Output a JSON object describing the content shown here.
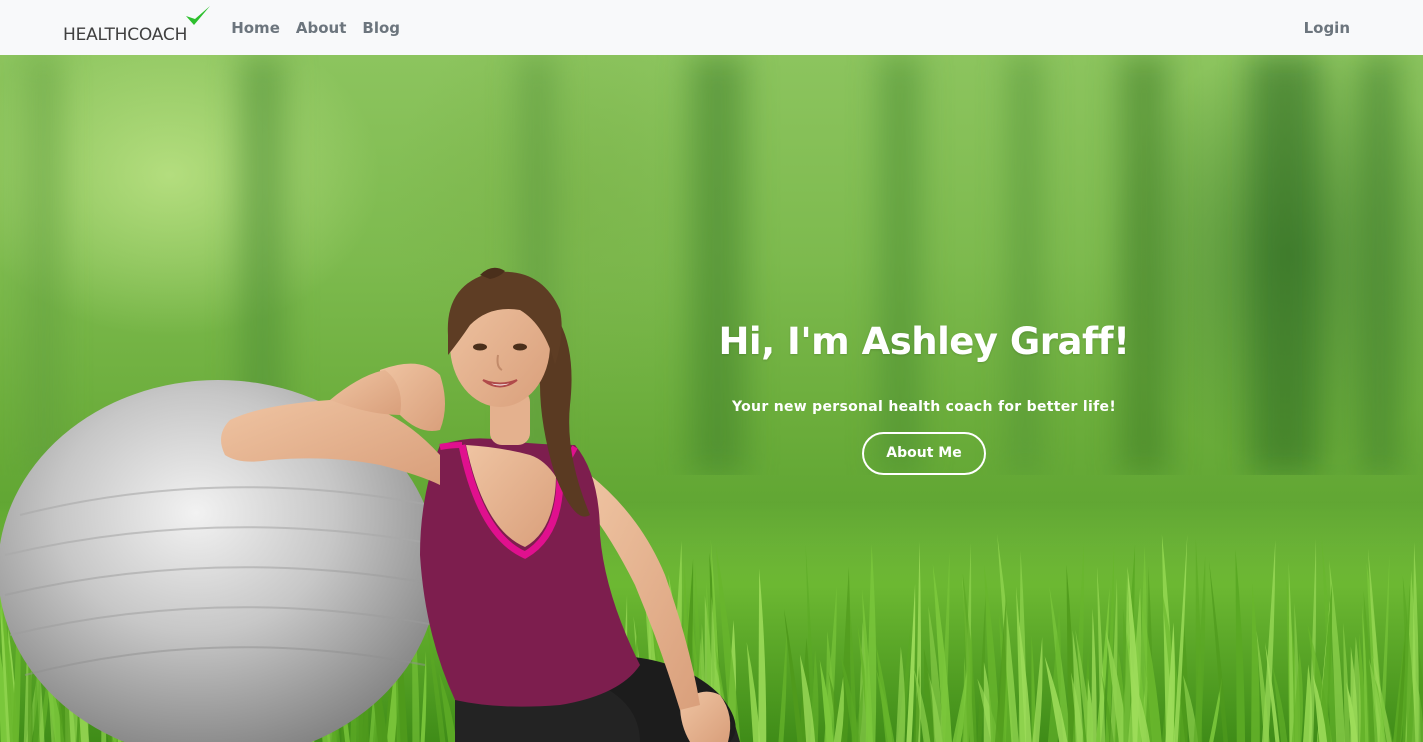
{
  "navbar": {
    "brand": "HEALTHCOACH",
    "links": [
      "Home",
      "About",
      "Blog"
    ],
    "login": "Login"
  },
  "hero": {
    "title": "Hi, I'm Ashley Graff!",
    "subtitle": "Your new personal health coach for better life!",
    "button": "About Me"
  },
  "colors": {
    "navbar_bg": "#f8f9fa",
    "nav_text": "#6c757d",
    "brand_check": "#2ec02e",
    "tank_top": "#7d1e4e",
    "tank_trim": "#e0108e",
    "grass": "#5da430"
  },
  "icons": {
    "brand_mark": "checkmark-icon"
  }
}
